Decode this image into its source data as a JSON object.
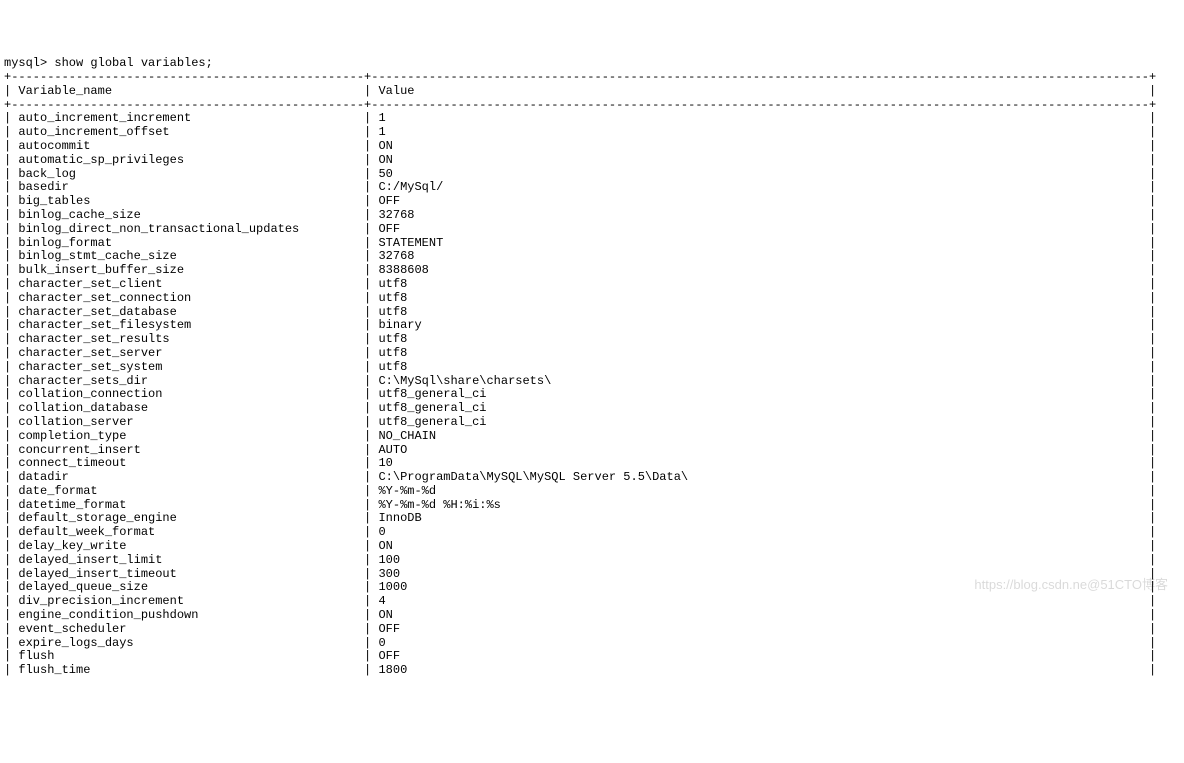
{
  "prompt": "mysql> ",
  "command": "show global variables;",
  "header": {
    "col1": "Variable_name",
    "col2": "Value"
  },
  "col1_width": 49,
  "col2_width": 108,
  "rows": [
    {
      "name": "auto_increment_increment",
      "value": "1"
    },
    {
      "name": "auto_increment_offset",
      "value": "1"
    },
    {
      "name": "autocommit",
      "value": "ON"
    },
    {
      "name": "automatic_sp_privileges",
      "value": "ON"
    },
    {
      "name": "back_log",
      "value": "50"
    },
    {
      "name": "basedir",
      "value": "C:/MySql/"
    },
    {
      "name": "big_tables",
      "value": "OFF"
    },
    {
      "name": "binlog_cache_size",
      "value": "32768"
    },
    {
      "name": "binlog_direct_non_transactional_updates",
      "value": "OFF"
    },
    {
      "name": "binlog_format",
      "value": "STATEMENT"
    },
    {
      "name": "binlog_stmt_cache_size",
      "value": "32768"
    },
    {
      "name": "bulk_insert_buffer_size",
      "value": "8388608"
    },
    {
      "name": "character_set_client",
      "value": "utf8"
    },
    {
      "name": "character_set_connection",
      "value": "utf8"
    },
    {
      "name": "character_set_database",
      "value": "utf8"
    },
    {
      "name": "character_set_filesystem",
      "value": "binary"
    },
    {
      "name": "character_set_results",
      "value": "utf8"
    },
    {
      "name": "character_set_server",
      "value": "utf8"
    },
    {
      "name": "character_set_system",
      "value": "utf8"
    },
    {
      "name": "character_sets_dir",
      "value": "C:\\MySql\\share\\charsets\\"
    },
    {
      "name": "collation_connection",
      "value": "utf8_general_ci"
    },
    {
      "name": "collation_database",
      "value": "utf8_general_ci"
    },
    {
      "name": "collation_server",
      "value": "utf8_general_ci"
    },
    {
      "name": "completion_type",
      "value": "NO_CHAIN"
    },
    {
      "name": "concurrent_insert",
      "value": "AUTO"
    },
    {
      "name": "connect_timeout",
      "value": "10"
    },
    {
      "name": "datadir",
      "value": "C:\\ProgramData\\MySQL\\MySQL Server 5.5\\Data\\"
    },
    {
      "name": "date_format",
      "value": "%Y-%m-%d"
    },
    {
      "name": "datetime_format",
      "value": "%Y-%m-%d %H:%i:%s"
    },
    {
      "name": "default_storage_engine",
      "value": "InnoDB"
    },
    {
      "name": "default_week_format",
      "value": "0"
    },
    {
      "name": "delay_key_write",
      "value": "ON"
    },
    {
      "name": "delayed_insert_limit",
      "value": "100"
    },
    {
      "name": "delayed_insert_timeout",
      "value": "300"
    },
    {
      "name": "delayed_queue_size",
      "value": "1000"
    },
    {
      "name": "div_precision_increment",
      "value": "4"
    },
    {
      "name": "engine_condition_pushdown",
      "value": "ON"
    },
    {
      "name": "event_scheduler",
      "value": "OFF"
    },
    {
      "name": "expire_logs_days",
      "value": "0"
    },
    {
      "name": "flush",
      "value": "OFF"
    },
    {
      "name": "flush_time",
      "value": "1800"
    }
  ],
  "watermark": "https://blog.csdn.ne@51CTO博客"
}
